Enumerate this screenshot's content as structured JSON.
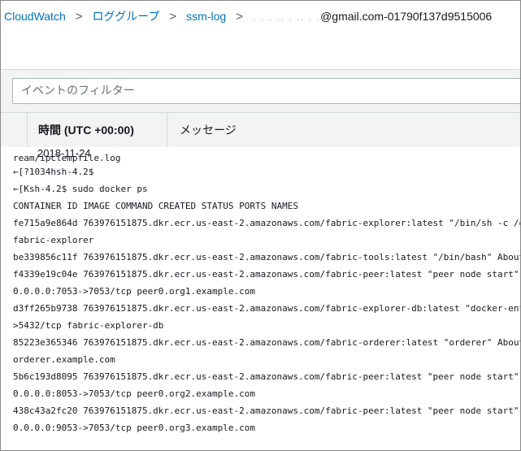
{
  "breadcrumb": {
    "items": [
      "CloudWatch",
      "ロググループ",
      "ssm-log"
    ],
    "separator": ">",
    "current_masked": ". . . .. . .. . .",
    "current_visible": "@gmail.com-01790f137d9515006"
  },
  "filter": {
    "placeholder": "イベントのフィルター"
  },
  "table": {
    "col_time": "時間 (UTC +00:00)",
    "col_message": "メッセージ"
  },
  "date_label": "2018-11-24",
  "log_lines": [
    "ream/ipclempfile.log",
    "←[?1034hsh-4.2$",
    "←[Ksh-4.2$ sudo docker ps",
    "CONTAINER ID IMAGE COMMAND CREATED STATUS PORTS NAMES",
    "fe715a9e864d 763976151875.dkr.ecr.us-east-2.amazonaws.com/fabric-explorer:latest \"/bin/sh -c /opt/",
    "fabric-explorer",
    "be339856c11f 763976151875.dkr.ecr.us-east-2.amazonaws.com/fabric-tools:latest \"/bin/bash\" About a",
    "f4339e19c04e 763976151875.dkr.ecr.us-east-2.amazonaws.com/fabric-peer:latest \"peer node start\" Abo",
    "0.0.0.0:7053->7053/tcp peer0.org1.example.com",
    "d3ff265b9738 763976151875.dkr.ecr.us-east-2.amazonaws.com/fabric-explorer-db:latest \"docker-entrypo",
    ">5432/tcp fabric-explorer-db",
    "85223e365346 763976151875.dkr.ecr.us-east-2.amazonaws.com/fabric-orderer:latest \"orderer\" About an",
    "orderer.example.com",
    "5b6c193d8095 763976151875.dkr.ecr.us-east-2.amazonaws.com/fabric-peer:latest \"peer node start\" Abo",
    "0.0.0.0:8053->7053/tcp peer0.org2.example.com",
    "438c43a2fc20 763976151875.dkr.ecr.us-east-2.amazonaws.com/fabric-peer:latest \"peer node start\" Abo",
    "0.0.0.0:9053->7053/tcp peer0.org3.example.com"
  ],
  "colors": {
    "link": "#0073bb",
    "panel_bg": "#f2f3f3",
    "border": "#d5dbdb"
  }
}
